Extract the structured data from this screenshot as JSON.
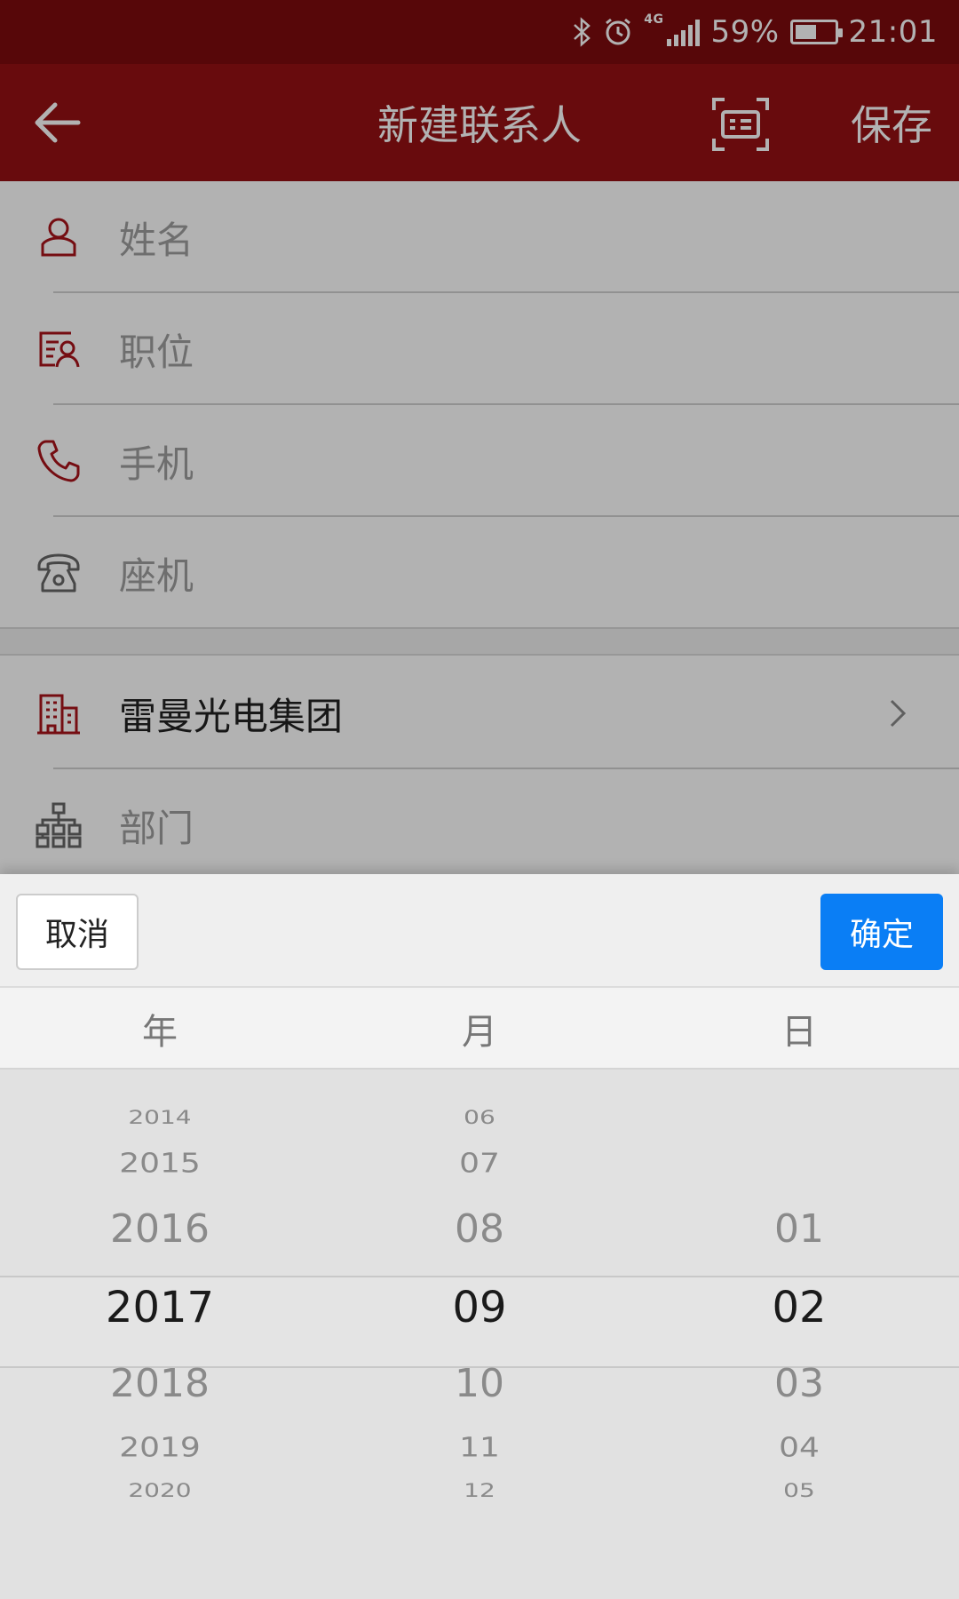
{
  "status_bar": {
    "battery_percent": "59%",
    "time": "21:01",
    "network": "4G",
    "icons": [
      "bluetooth-icon",
      "alarm-icon",
      "signal-icon",
      "battery-icon"
    ]
  },
  "app_bar": {
    "title": "新建联系人",
    "save_label": "保存",
    "icons": [
      "back-arrow-icon",
      "card-scan-icon"
    ]
  },
  "form": {
    "fields": [
      {
        "icon": "person-icon",
        "placeholder": "姓名"
      },
      {
        "icon": "id-card-icon",
        "placeholder": "职位"
      },
      {
        "icon": "phone-icon",
        "placeholder": "手机"
      },
      {
        "icon": "landline-phone-icon",
        "placeholder": "座机"
      }
    ],
    "company": {
      "icon": "building-icon",
      "value": "雷曼光电集团",
      "chevron": "chevron-right-icon"
    },
    "department": {
      "icon": "org-chart-icon",
      "placeholder": "部门"
    }
  },
  "date_picker": {
    "cancel_label": "取消",
    "confirm_label": "确定",
    "columns": {
      "year": {
        "header": "年",
        "items": [
          "2014",
          "2015",
          "2016",
          "2017",
          "2018",
          "2019",
          "2020"
        ],
        "selected": "2017"
      },
      "month": {
        "header": "月",
        "items": [
          "06",
          "07",
          "08",
          "09",
          "10",
          "11",
          "12"
        ],
        "selected": "09"
      },
      "day": {
        "header": "日",
        "items": [
          "01",
          "02",
          "03",
          "04",
          "05"
        ],
        "selected": "02"
      }
    }
  },
  "colors": {
    "status_bar": "#7d0b0e",
    "app_bar": "#961014",
    "accent_icon": "#a8141a",
    "confirm_button": "#0a7ef5"
  }
}
